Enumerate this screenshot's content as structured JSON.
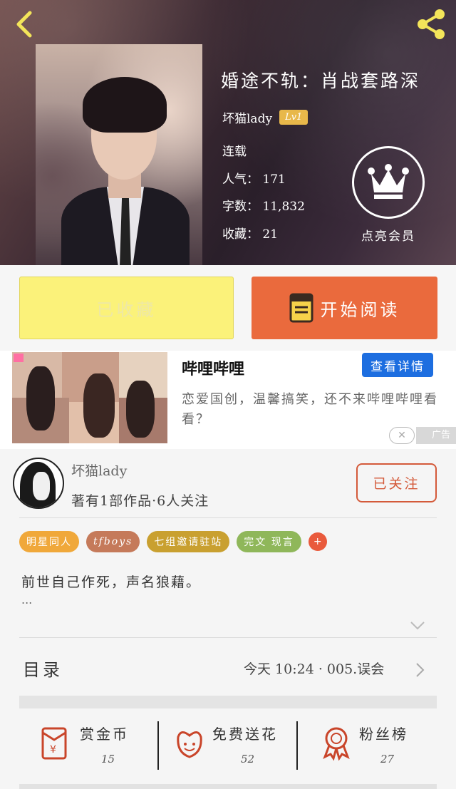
{
  "header": {
    "title": "婚途不轨：肖战套路深",
    "author": "坏猫lady",
    "level": "Lv1",
    "status": "连载",
    "stats": [
      {
        "label": "人气：",
        "value": "171"
      },
      {
        "label": "字数：",
        "value": "11,832"
      },
      {
        "label": "收藏：",
        "value": "21"
      }
    ],
    "vip_label": "点亮会员"
  },
  "actions": {
    "collected_label": "已收藏",
    "read_label": "开始阅读"
  },
  "ad": {
    "title": "哔哩哔哩",
    "button": "查看详情",
    "description": "恋爱国创，温馨搞笑，还不来哔哩哔哩看看？",
    "label": "广告"
  },
  "author_section": {
    "name": "坏猫lady",
    "meta": "著有1部作品·6人关注",
    "follow_label": "已关注"
  },
  "tags": [
    {
      "label": "明星同人",
      "color": "#f0a83a"
    },
    {
      "label": "tfboys",
      "color": "#c57a5a"
    },
    {
      "label": "七组邀请驻站",
      "color": "#c9a030"
    },
    {
      "label": "完文 现言",
      "color": "#8fb75a"
    }
  ],
  "tag_more": "+",
  "summary": "前世自己作死，声名狼藉。",
  "summary_more": "...",
  "toc": {
    "label": "目录",
    "latest": "今天 10:24 · 005.误会"
  },
  "bottom_stats": [
    {
      "label": "赏金币",
      "count": "15"
    },
    {
      "label": "免费送花",
      "count": "52"
    },
    {
      "label": "粉丝榜",
      "count": "27"
    }
  ],
  "colors": {
    "accent": "#ea6a3d",
    "collected": "#fbf27a",
    "ad_button": "#1d6ee0",
    "icon_red": "#c9452a"
  }
}
